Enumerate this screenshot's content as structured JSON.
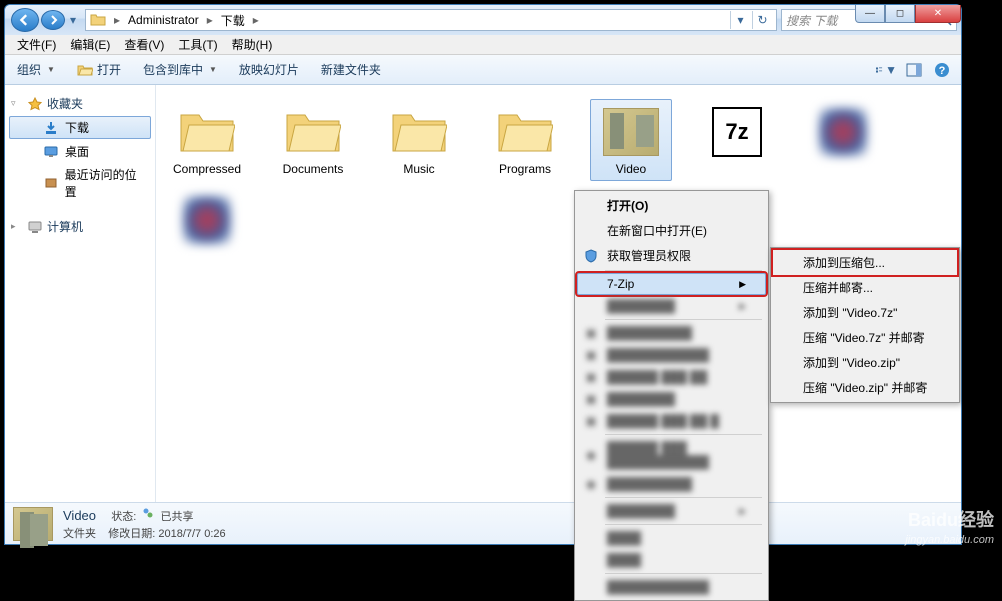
{
  "breadcrumb": {
    "parts": [
      "Administrator",
      "下载"
    ]
  },
  "search": {
    "placeholder": "搜索 下载"
  },
  "menubar": {
    "file": "文件(F)",
    "edit": "编辑(E)",
    "view": "查看(V)",
    "tools": "工具(T)",
    "help": "帮助(H)"
  },
  "toolbar": {
    "organize": "组织",
    "open": "打开",
    "include": "包含到库中",
    "slideshow": "放映幻灯片",
    "newfolder": "新建文件夹"
  },
  "sidebar": {
    "favorites": "收藏夹",
    "downloads": "下载",
    "desktop": "桌面",
    "recent": "最近访问的位置",
    "computer": "计算机"
  },
  "items": [
    {
      "label": "Compressed"
    },
    {
      "label": "Documents"
    },
    {
      "label": "Music"
    },
    {
      "label": "Programs"
    },
    {
      "label": "Video",
      "selected": true,
      "kind": "video"
    },
    {
      "label": "",
      "kind": "7z"
    },
    {
      "label": "",
      "kind": "blur"
    },
    {
      "label": "",
      "kind": "blur"
    }
  ],
  "context": {
    "open": "打开(O)",
    "open_new": "在新窗口中打开(E)",
    "admin": "获取管理员权限",
    "sevenzip": "7-Zip",
    "sub": {
      "add": "添加到压缩包...",
      "compress_email": "压缩并邮寄...",
      "add_7z": "添加到 \"Video.7z\"",
      "compress_7z_email": "压缩 \"Video.7z\" 并邮寄",
      "add_zip": "添加到 \"Video.zip\"",
      "compress_zip_email": "压缩 \"Video.zip\" 并邮寄"
    }
  },
  "status": {
    "name": "Video",
    "state_label": "状态:",
    "shared": "已共享",
    "type": "文件夹",
    "modified_label": "修改日期:",
    "modified": "2018/7/7 0:26"
  },
  "watermark": {
    "line1": "Baidu经验",
    "line2": "jingyan.baidu.com"
  }
}
